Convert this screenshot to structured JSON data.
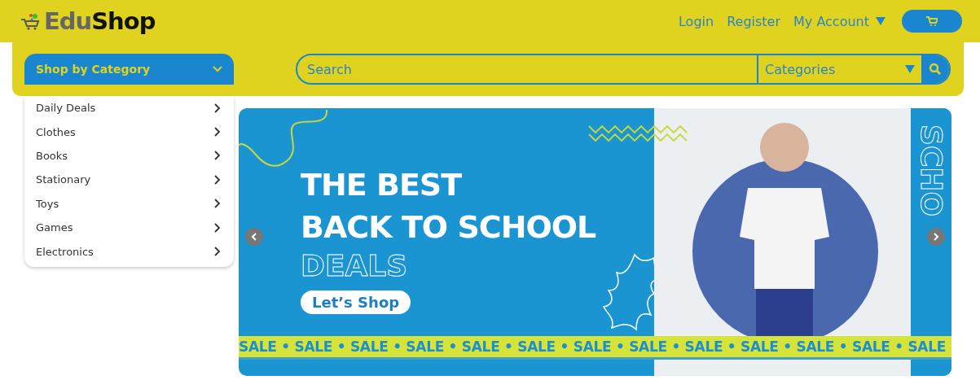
{
  "logo": {
    "part_1": "Edu",
    "part_2": "Shop"
  },
  "nav": {
    "links": [
      "Login",
      "Register",
      "My Account"
    ]
  },
  "category_menu": {
    "title": "Shop by Category",
    "expanded": true,
    "items": [
      "Daily Deals",
      "Clothes",
      "Books",
      "Stationary",
      "Toys",
      "Games",
      "Electronics"
    ]
  },
  "search": {
    "placeholder": "Search",
    "category_select": "Categories"
  },
  "banner": {
    "line_1": "THE BEST",
    "line_2": "BACK TO SCHOOL",
    "line_3": "DEALS",
    "button": "Let’s Shop",
    "side_text": "SCHO",
    "ribbon": "SALE • SALE • SALE • SALE • SALE • SALE • SALE • SALE • SALE • SALE • SALE • SALE • SALE"
  }
}
